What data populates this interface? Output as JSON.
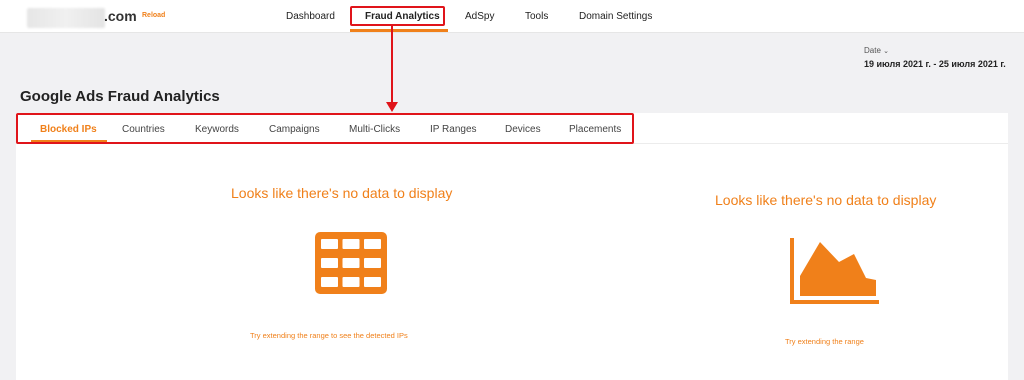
{
  "header": {
    "domain_suffix": ".com",
    "reload_label": "Reload",
    "nav": [
      {
        "label": "Dashboard"
      },
      {
        "label": "Fraud Analytics"
      },
      {
        "label": "AdSpy"
      },
      {
        "label": "Tools"
      },
      {
        "label": "Domain Settings"
      }
    ],
    "active_nav": "Fraud Analytics"
  },
  "date": {
    "label": "Date",
    "range": "19 июля 2021 г. - 25 июля 2021 г."
  },
  "page": {
    "title": "Google Ads Fraud Analytics"
  },
  "tabs": [
    {
      "label": "Blocked IPs"
    },
    {
      "label": "Countries"
    },
    {
      "label": "Keywords"
    },
    {
      "label": "Campaigns"
    },
    {
      "label": "Multi-Clicks"
    },
    {
      "label": "IP Ranges"
    },
    {
      "label": "Devices"
    },
    {
      "label": "Placements"
    }
  ],
  "active_tab": "Blocked IPs",
  "left_panel": {
    "empty_title": "Looks like there's no data to display",
    "icon": "table-grid-icon",
    "hint": "Try extending the range to see the detected IPs"
  },
  "right_panel": {
    "empty_title": "Looks like there's no data to display",
    "icon": "area-chart-icon",
    "hint": "Try extending the range"
  },
  "colors": {
    "accent": "#f0801a",
    "annotation_red": "#e0141a",
    "background": "#f1f1f3"
  }
}
